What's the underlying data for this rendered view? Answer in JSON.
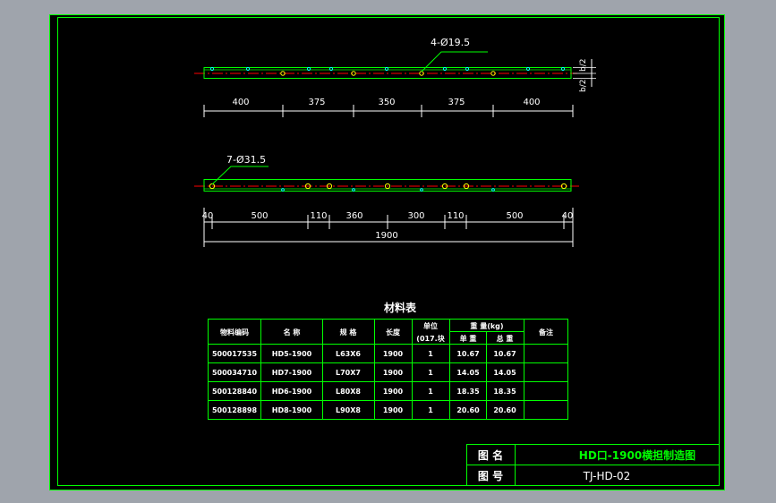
{
  "drawing": {
    "top_view": {
      "hole_callout": "4-Ø19.5",
      "side_dims": [
        "b/2",
        "b/2"
      ],
      "dimensions": [
        "400",
        "375",
        "350",
        "375",
        "400"
      ]
    },
    "front_view": {
      "hole_callout": "7-Ø31.5",
      "dimensions": [
        "40",
        "500",
        "110",
        "360",
        "300",
        "110",
        "500",
        "40"
      ],
      "overall": "1900"
    }
  },
  "material_table": {
    "title": "材料表",
    "headers": {
      "code": "物料编码",
      "name": "名 称",
      "spec": "规 格",
      "length": "长度",
      "unit_top": "单位",
      "unit_bottom": "(017.块",
      "weight": "重 量(kg)",
      "unit_weight": "单 重",
      "total_weight": "总 重",
      "remark": "备注"
    },
    "rows": [
      {
        "code": "500017535",
        "name": "HD5-1900",
        "spec": "L63X6",
        "length": "1900",
        "qty": "1",
        "unit_weight": "10.67",
        "total_weight": "10.67",
        "remark": ""
      },
      {
        "code": "500034710",
        "name": "HD7-1900",
        "spec": "L70X7",
        "length": "1900",
        "qty": "1",
        "unit_weight": "14.05",
        "total_weight": "14.05",
        "remark": ""
      },
      {
        "code": "500128840",
        "name": "HD6-1900",
        "spec": "L80X8",
        "length": "1900",
        "qty": "1",
        "unit_weight": "18.35",
        "total_weight": "18.35",
        "remark": ""
      },
      {
        "code": "500128898",
        "name": "HD8-1900",
        "spec": "L90X8",
        "length": "1900",
        "qty": "1",
        "unit_weight": "20.60",
        "total_weight": "20.60",
        "remark": ""
      }
    ]
  },
  "title_block": {
    "name_label": "图 名",
    "name_value": "HD口-1900横担制造图",
    "number_label": "图 号",
    "number_value": "TJ-HD-02"
  },
  "colors": {
    "background": "#000000",
    "frame": "#00ff00",
    "dimension": "#ffffff",
    "centerline": "#ff0000",
    "hole_cyan": "#00ffff",
    "hole_yellow": "#ffff00",
    "title_green": "#00ff00"
  }
}
